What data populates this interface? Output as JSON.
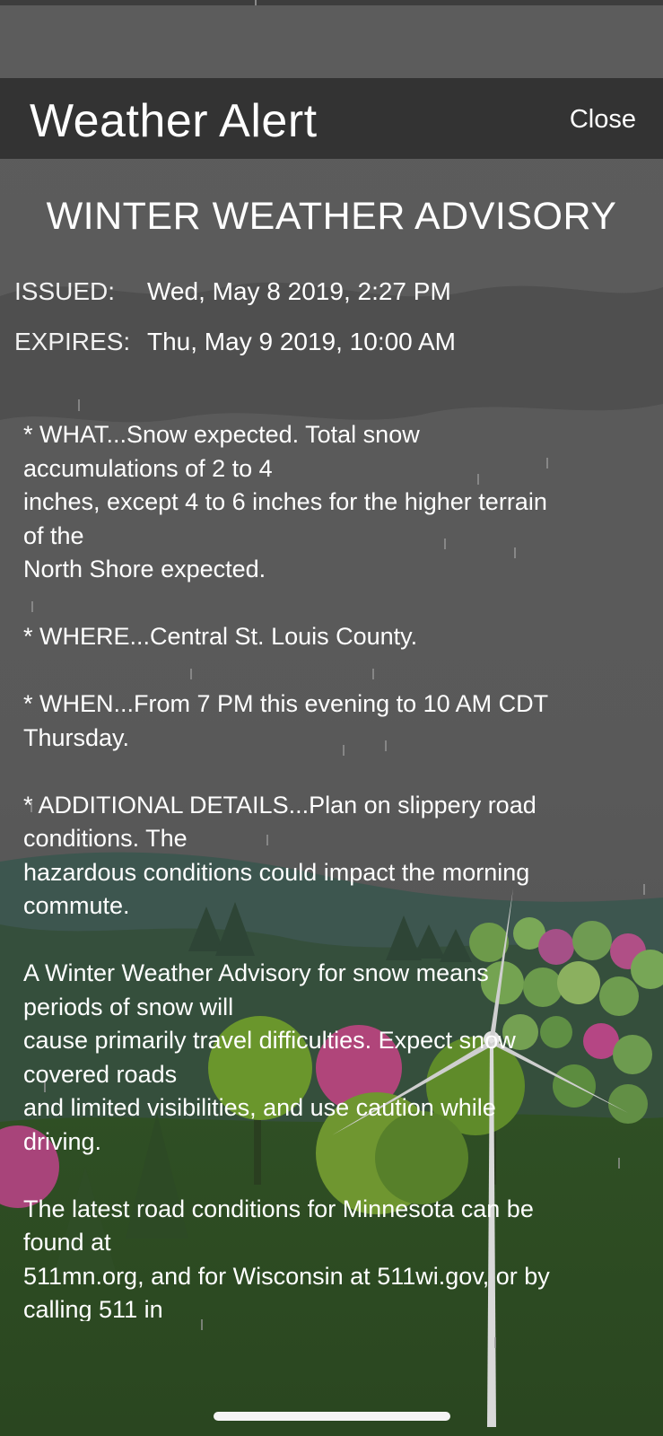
{
  "header": {
    "title": "Weather Alert",
    "close_label": "Close"
  },
  "alert": {
    "headline": "WINTER WEATHER ADVISORY",
    "issued_label": "ISSUED:",
    "issued_value": "Wed, May 8 2019, 2:27 PM",
    "expires_label": "EXPIRES:",
    "expires_value": "Thu, May 9 2019, 10:00 AM",
    "description": "* WHAT...Snow expected. Total snow\naccumulations of 2 to 4\ninches, except 4 to 6 inches for the higher terrain\nof the\nNorth Shore expected.\n\n* WHERE...Central St. Louis County.\n\n* WHEN...From 7 PM this evening to 10 AM CDT\nThursday.\n\n* ADDITIONAL DETAILS...Plan on slippery road\nconditions. The\nhazardous conditions could impact the morning\ncommute.\n\nA Winter Weather Advisory for snow means\nperiods of snow will\ncause primarily travel difficulties. Expect snow\ncovered roads\nand limited visibilities, and use caution while\ndriving.\n\nThe latest road conditions for Minnesota can be\nfound at\n511mn.org, and for Wisconsin at 511wi.gov, or by\ncalling 511 in"
  },
  "colors": {
    "header_bg": "#303030",
    "sky": "#5a5a5a",
    "hill": "#3e5a52",
    "ground": "#2c4a1e",
    "tree_pink": "#b0457a",
    "tree_green": "#5f8f2c"
  },
  "icons": {
    "home_indicator": "home-indicator-bar"
  }
}
